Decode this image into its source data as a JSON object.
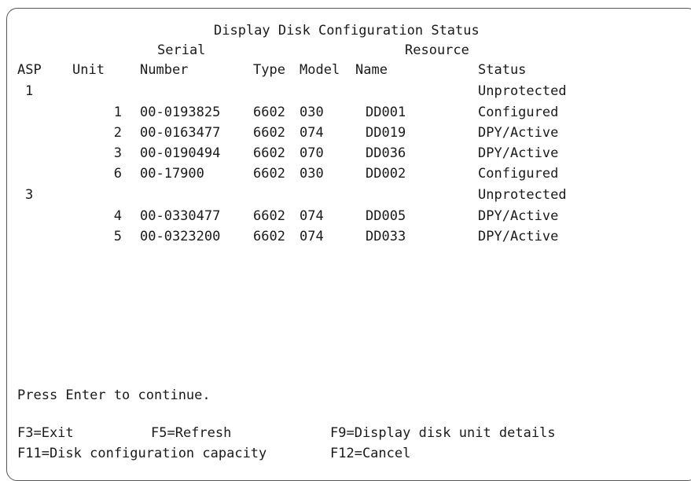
{
  "screen": {
    "title": "Display Disk Configuration Status",
    "headers": {
      "serial_top": "Serial",
      "resource_top": "Resource",
      "asp": "ASP",
      "unit": "Unit",
      "number": "Number",
      "type": "Type",
      "model": "Model",
      "name": "Name",
      "status": "Status"
    },
    "asp_groups": [
      {
        "asp": "1",
        "status": "Unprotected",
        "units": [
          {
            "unit": "1",
            "serial": "00-0193825",
            "type": "6602",
            "model": "030",
            "resource": "DD001",
            "status": "Configured"
          },
          {
            "unit": "2",
            "serial": "00-0163477",
            "type": "6602",
            "model": "074",
            "resource": "DD019",
            "status": "DPY/Active"
          },
          {
            "unit": "3",
            "serial": "00-0190494",
            "type": "6602",
            "model": "070",
            "resource": "DD036",
            "status": "DPY/Active"
          },
          {
            "unit": "6",
            "serial": "00-17900",
            "type": "6602",
            "model": "030",
            "resource": "DD002",
            "status": "Configured"
          }
        ]
      },
      {
        "asp": "3",
        "status": "Unprotected",
        "units": [
          {
            "unit": "4",
            "serial": "00-0330477",
            "type": "6602",
            "model": "074",
            "resource": "DD005",
            "status": "DPY/Active"
          },
          {
            "unit": "5",
            "serial": "00-0323200",
            "type": "6602",
            "model": "074",
            "resource": "DD033",
            "status": "DPY/Active"
          }
        ]
      }
    ],
    "prompt": "Press Enter to continue.",
    "function_keys": {
      "f3": "F3=Exit",
      "f5": "F5=Refresh",
      "f9": "F9=Display disk unit details",
      "f11": "F11=Disk configuration capacity",
      "f12": "F12=Cancel"
    }
  }
}
